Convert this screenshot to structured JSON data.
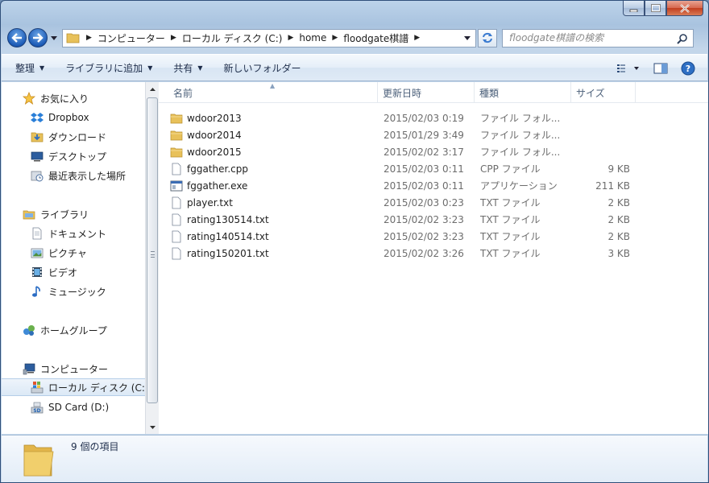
{
  "window": {
    "minimize": "minimize",
    "maximize": "maximize",
    "close": "close"
  },
  "address": {
    "crumbs": [
      "コンピューター",
      "ローカル ディスク (C:)",
      "home",
      "floodgate棋譜"
    ]
  },
  "search": {
    "placeholder": "floodgate棋譜の検索"
  },
  "toolbar": {
    "organize": "整理",
    "include_library": "ライブラリに追加",
    "share": "共有",
    "new_folder": "新しいフォルダー"
  },
  "nav": {
    "favorites": "お気に入り",
    "dropbox": "Dropbox",
    "downloads": "ダウンロード",
    "desktop": "デスクトップ",
    "recent": "最近表示した場所",
    "libraries": "ライブラリ",
    "documents": "ドキュメント",
    "pictures": "ピクチャ",
    "videos": "ビデオ",
    "music": "ミュージック",
    "homegroup": "ホームグループ",
    "computer": "コンピューター",
    "local_disk": "ローカル ディスク (C:)",
    "sd_card": "SD Card (D:)"
  },
  "columns": {
    "name": "名前",
    "modified": "更新日時",
    "type": "種類",
    "size": "サイズ"
  },
  "files": [
    {
      "name": "wdoor2013",
      "date": "2015/02/03 0:19",
      "type": "ファイル フォル...",
      "size": "",
      "icon": "folder-icon"
    },
    {
      "name": "wdoor2014",
      "date": "2015/01/29 3:49",
      "type": "ファイル フォル...",
      "size": "",
      "icon": "folder-icon"
    },
    {
      "name": "wdoor2015",
      "date": "2015/02/02 3:17",
      "type": "ファイル フォル...",
      "size": "",
      "icon": "folder-icon"
    },
    {
      "name": "fggather.cpp",
      "date": "2015/02/03 0:11",
      "type": "CPP ファイル",
      "size": "9 KB",
      "icon": "document-icon"
    },
    {
      "name": "fggather.exe",
      "date": "2015/02/03 0:11",
      "type": "アプリケーション",
      "size": "211 KB",
      "icon": "application-icon"
    },
    {
      "name": "player.txt",
      "date": "2015/02/03 0:23",
      "type": "TXT ファイル",
      "size": "2 KB",
      "icon": "document-icon"
    },
    {
      "name": "rating130514.txt",
      "date": "2015/02/02 3:23",
      "type": "TXT ファイル",
      "size": "2 KB",
      "icon": "document-icon"
    },
    {
      "name": "rating140514.txt",
      "date": "2015/02/02 3:23",
      "type": "TXT ファイル",
      "size": "2 KB",
      "icon": "document-icon"
    },
    {
      "name": "rating150201.txt",
      "date": "2015/02/02 3:26",
      "type": "TXT ファイル",
      "size": "3 KB",
      "icon": "document-icon"
    }
  ],
  "details": {
    "item_count": "9 個の項目"
  },
  "colors": {
    "folder": "#e8c15a",
    "accent": "#1c5bb7",
    "close": "#c23e1f"
  }
}
